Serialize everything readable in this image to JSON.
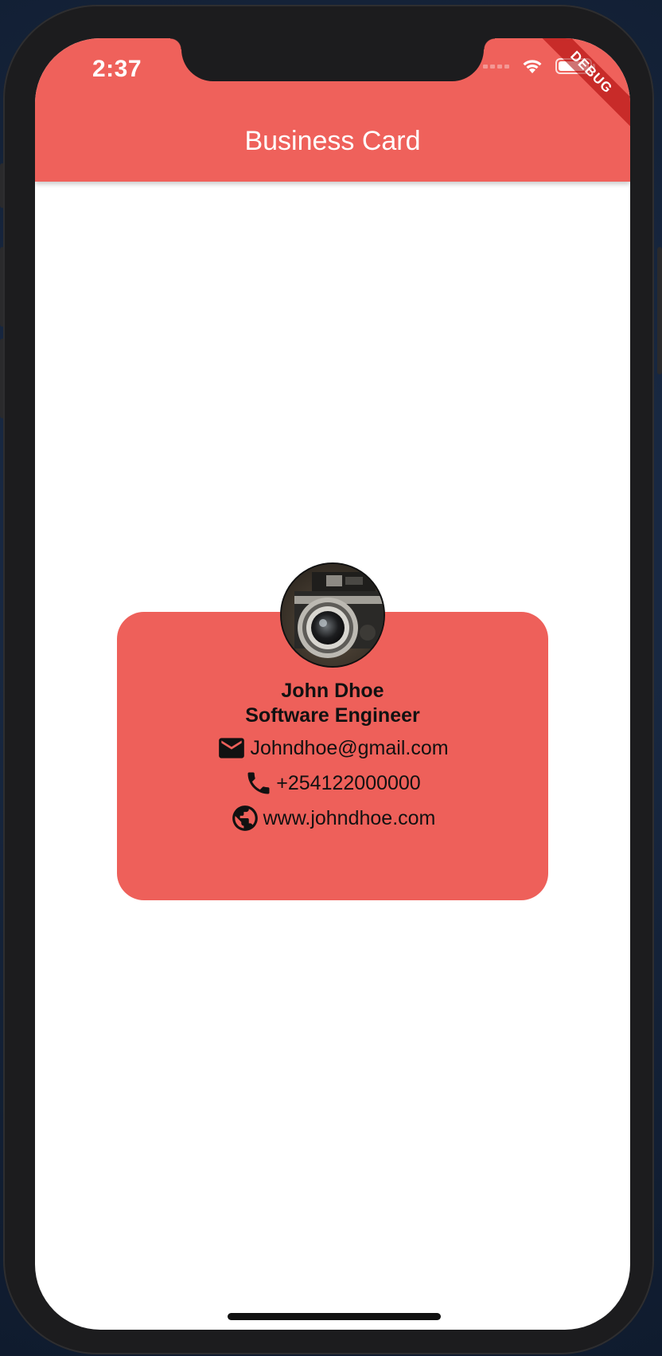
{
  "status_bar": {
    "time": "2:37",
    "battery_level": 1.0
  },
  "debug_banner": {
    "label": "DEBUG"
  },
  "app_bar": {
    "title": "Business Card",
    "color": "#ef615b"
  },
  "card": {
    "color": "#ee605a",
    "avatar_icon": "camera-photo",
    "name": "John Dhoe",
    "job_title": "Software Engineer",
    "contacts": [
      {
        "icon": "mail-icon",
        "text": "Johndhoe@gmail.com"
      },
      {
        "icon": "phone-icon",
        "text": "+254122000000"
      },
      {
        "icon": "globe-icon",
        "text": "www.johndhoe.com"
      }
    ]
  }
}
